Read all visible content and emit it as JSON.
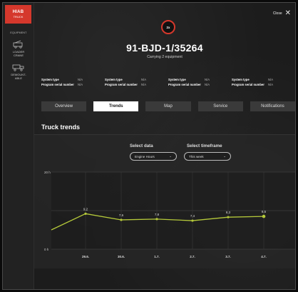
{
  "sidebar": {
    "brand": {
      "logo": "HIAB",
      "sub": "TRUCK"
    },
    "section_label": "EQUIPMENT",
    "items": [
      {
        "label_line1": "LOADER",
        "label_line2": "CRANE",
        "icon": "crane-icon"
      },
      {
        "label_line1": "DEMOUNT-",
        "label_line2": "ABLE",
        "icon": "demountable-icon"
      }
    ]
  },
  "header": {
    "close_label": "Close",
    "badge_text": "2x",
    "title": "91-BJD-1/35264",
    "subtitle": "Carrying 2 equipment"
  },
  "specs": [
    {
      "system_type_label": "System type",
      "system_type_value": "N/A",
      "serial_label": "Program serial number",
      "serial_value": "N/A"
    },
    {
      "system_type_label": "System type",
      "system_type_value": "N/A",
      "serial_label": "Program serial number",
      "serial_value": "N/A"
    },
    {
      "system_type_label": "System type",
      "system_type_value": "N/A",
      "serial_label": "Program serial number",
      "serial_value": "N/A"
    },
    {
      "system_type_label": "System type",
      "system_type_value": "N/A",
      "serial_label": "Program serial number",
      "serial_value": "N/A"
    }
  ],
  "tabs": [
    {
      "label": "Overview",
      "active": false
    },
    {
      "label": "Trends",
      "active": true
    },
    {
      "label": "Map",
      "active": false
    },
    {
      "label": "Service",
      "active": false
    },
    {
      "label": "Notifications",
      "active": false
    }
  ],
  "trends": {
    "section_title": "Truck trends",
    "select_data_label": "Select data",
    "select_data_value": "Engine Hours",
    "select_timeframe_label": "Select timeframe",
    "select_timeframe_value": "This week"
  },
  "chart_data": {
    "type": "line",
    "x": [
      "29.6.",
      "30.6.",
      "1.7.",
      "2.7.",
      "3.7.",
      "4.7."
    ],
    "values": [
      9.2,
      7.6,
      7.8,
      7.4,
      8.3,
      8.5
    ],
    "value_labels": [
      "9,2",
      "7,6",
      "7,8",
      "7,4",
      "8,3",
      "8,5"
    ],
    "y_tick_labels": [
      "20 h",
      "0 h"
    ],
    "ylim": [
      0,
      20
    ],
    "line_color": "#b5c93a",
    "grid": true
  }
}
